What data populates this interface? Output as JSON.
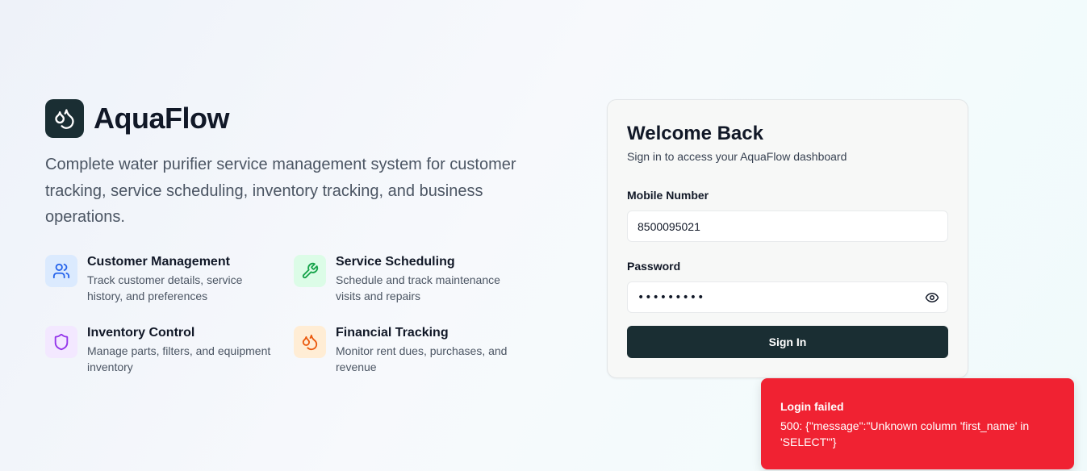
{
  "brand": {
    "name": "AquaFlow",
    "tagline": "Complete water purifier service management system for customer tracking, service scheduling, inventory tracking, and business operations."
  },
  "features": [
    {
      "title": "Customer Management",
      "description": "Track customer details, service history, and preferences",
      "icon": "users-icon",
      "color": "#2563eb",
      "bg": "#dbeafe"
    },
    {
      "title": "Service Scheduling",
      "description": "Schedule and track maintenance visits and repairs",
      "icon": "wrench-icon",
      "color": "#16a34a",
      "bg": "#dcfce7"
    },
    {
      "title": "Inventory Control",
      "description": "Manage parts, filters, and equipment inventory",
      "icon": "shield-icon",
      "color": "#9333ea",
      "bg": "#f3e8ff"
    },
    {
      "title": "Financial Tracking",
      "description": "Monitor rent dues, purchases, and revenue",
      "icon": "droplets-icon",
      "color": "#ea580c",
      "bg": "#ffedd5"
    }
  ],
  "login": {
    "title": "Welcome Back",
    "subtitle": "Sign in to access your AquaFlow dashboard",
    "mobile_label": "Mobile Number",
    "mobile_value": "8500095021",
    "password_label": "Password",
    "password_mask": "•••••••••",
    "submit_label": "Sign In",
    "button_color": "#1a2e33"
  },
  "toast": {
    "title": "Login failed",
    "message": "500: {\"message\":\"Unknown column 'first_name' in 'SELECT'\"}",
    "color": "#f02232"
  }
}
